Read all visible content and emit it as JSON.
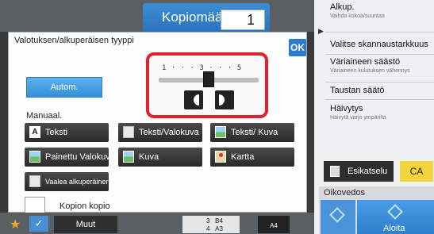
{
  "header": {
    "copies_label": "Kopiomäärä",
    "copies_value": "1"
  },
  "dialog": {
    "title": "Valotuksen/alkuperäisen tyyppi",
    "ok_label": "OK",
    "auto_label": "Autom.",
    "manual_label": "Manuaal.",
    "exposure_scale": "1 · · · 3 · · · 5",
    "exposure_level": 3,
    "type_buttons": [
      {
        "label": "Teksti",
        "icon": "text-icon"
      },
      {
        "label": "Teksti/Valokuva",
        "icon": "document-icon"
      },
      {
        "label": "Teksti/ Kuva",
        "icon": "photo-icon"
      },
      {
        "label": "Painettu Valokuva",
        "icon": "photo-icon"
      },
      {
        "label": "Kuva",
        "icon": "photo-icon"
      },
      {
        "label": "Kartta",
        "icon": "map-icon"
      },
      {
        "label": "Vaalea alkuperäinen",
        "icon": "document-icon"
      }
    ],
    "copy_of_copy_label": "Kopion kopio"
  },
  "bottom_bar": {
    "more_label": "Muut",
    "tray1_num": "3",
    "tray1_size": "B4",
    "tray2_num": "4",
    "tray2_size": "A3",
    "paper_size": "A4"
  },
  "right_panel": {
    "items": [
      {
        "label": "Alkup.",
        "sub": "Vaihda kokoa/suuntaa"
      },
      {
        "label": "Valitse skannaustarkkuus",
        "sub": ""
      },
      {
        "label": "Väriaineen säästö",
        "sub": "Väriaineen kulutuksen vähennys"
      },
      {
        "label": "Taustan säätö",
        "sub": ""
      },
      {
        "label": "Häivytys",
        "sub": "Häivytä varjo ympäriltä"
      }
    ],
    "preview_label": "Esikatselu",
    "ca_label": "CA",
    "proof_label": "Oikovedos",
    "start_label": "Aloita"
  },
  "colors": {
    "accent_blue": "#2b7bd0",
    "highlight_red": "#e0222e",
    "ca_yellow": "#f3d53a"
  }
}
